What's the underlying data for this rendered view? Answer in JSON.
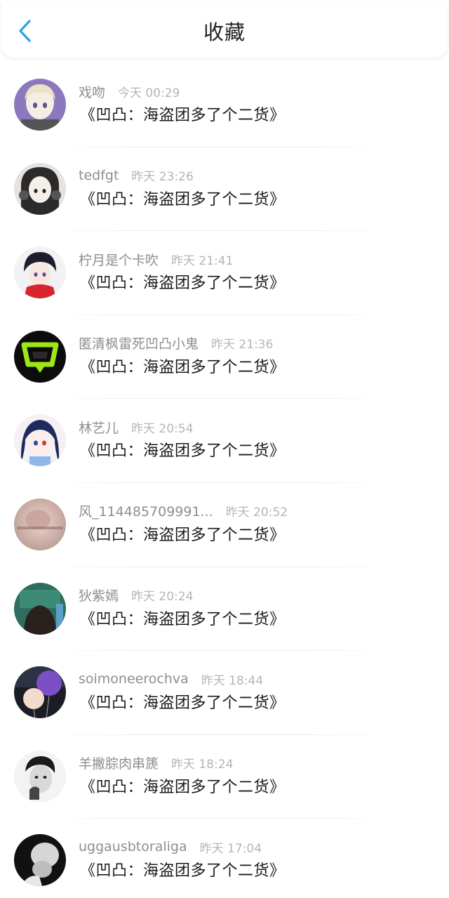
{
  "header": {
    "title": "收藏",
    "back_icon": "chevron-left-icon",
    "accent_color": "#2aa3e8"
  },
  "items": [
    {
      "username": "戏吻",
      "time": "今天 00:29",
      "content": "《凹凸：海盗团多了个二货》",
      "avatar_icon": "anime-avatar-icon"
    },
    {
      "username": "tedfgt",
      "time": "昨天 23:26",
      "content": "《凹凸：海盗团多了个二货》",
      "avatar_icon": "anime-avatar-icon"
    },
    {
      "username": "柠月是个卡吹",
      "time": "昨天 21:41",
      "content": "《凹凸：海盗团多了个二货》",
      "avatar_icon": "anime-avatar-icon"
    },
    {
      "username": "匿清枫雷死凹凸小鬼",
      "time": "昨天 21:36",
      "content": "《凹凸：海盗团多了个二货》",
      "avatar_icon": "logo-avatar-icon"
    },
    {
      "username": "林艺儿",
      "time": "昨天 20:54",
      "content": "《凹凸：海盗团多了个二货》",
      "avatar_icon": "anime-avatar-icon"
    },
    {
      "username": "风_114485709991...",
      "time": "昨天 20:52",
      "content": "《凹凸：海盗团多了个二货》",
      "avatar_icon": "photo-avatar-icon"
    },
    {
      "username": "狄紫嫣",
      "time": "昨天 20:24",
      "content": "《凹凸：海盗团多了个二货》",
      "avatar_icon": "anime-avatar-icon"
    },
    {
      "username": "soimoneerochva",
      "time": "昨天 18:44",
      "content": "《凹凸：海盗团多了个二货》",
      "avatar_icon": "balloon-avatar-icon"
    },
    {
      "username": "羊撇腙肉串篪",
      "time": "昨天 18:24",
      "content": "《凹凸：海盗团多了个二货》",
      "avatar_icon": "photo-avatar-icon"
    },
    {
      "username": "uggausbtoraliga",
      "time": "昨天 17:04",
      "content": "《凹凸：海盗团多了个二货》",
      "avatar_icon": "photo-avatar-icon"
    }
  ]
}
